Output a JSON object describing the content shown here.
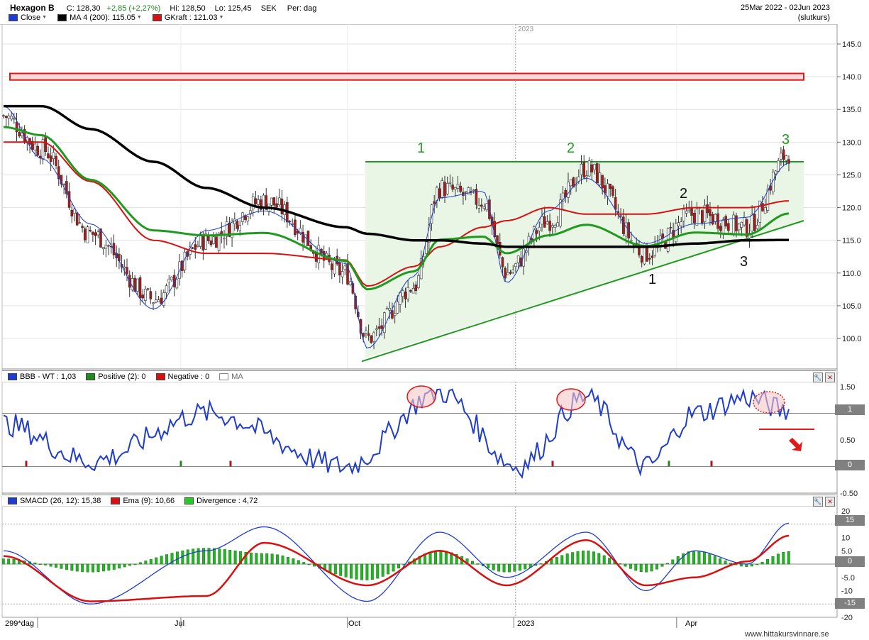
{
  "header": {
    "ticker": "Hexagon B",
    "close": "C: 128,30",
    "change": "+2,85 (+2,27%)",
    "high": "Hi: 128,50",
    "low": "Lo: 125,45",
    "currency": "SEK",
    "period": "Per: dag",
    "range": "25Mar 2022 - 02Jun 2023",
    "range_note": "(slutkurs)",
    "legend": [
      {
        "label": "Close",
        "color": "#1f3cd1"
      },
      {
        "label": "MA 4 (200): 115.05",
        "color": "#000000"
      },
      {
        "label": "GKraft : 121.03",
        "color": "#d81010"
      }
    ]
  },
  "colors": {
    "price_up": "#ffffff",
    "price_down": "#b01818",
    "ma200": "#000000",
    "ma_green": "#1f9a1f",
    "ma_red": "#d81010",
    "blue": "#1f3cd1",
    "resistance_box": "#e01818",
    "triangle_fill": "#e9f6e6",
    "triangle_line": "#1f9a1f"
  },
  "price_axis": {
    "ticks": [
      "145.0",
      "140.0",
      "135.0",
      "130.0",
      "125.0",
      "120.0",
      "115.0",
      "110.0",
      "105.0",
      "100.0"
    ]
  },
  "year_label": "2023",
  "annotations": {
    "green_1": "1",
    "green_2": "2",
    "green_3": "3",
    "black_1": "1",
    "black_2": "2",
    "black_3": "3"
  },
  "bbb_pane": {
    "legend": [
      {
        "label": "BBB - WT : 1,03",
        "color": "#1f3cd1"
      },
      {
        "label": "Positive (2): 0",
        "color": "#1f8a1f"
      },
      {
        "label": "Negative : 0",
        "color": "#d81010"
      },
      {
        "label": "MA",
        "color": "#ffffff"
      }
    ],
    "ticks": [
      "1.50",
      "0.50",
      "-0.50"
    ],
    "tags": [
      "1",
      "0"
    ]
  },
  "smacd_pane": {
    "legend": [
      {
        "label": "SMACD (26, 12): 15,38",
        "color": "#1f3cd1"
      },
      {
        "label": "Ema (9): 10,66",
        "color": "#d81010"
      },
      {
        "label": "Divergence : 4,72",
        "color": "#22cc22"
      }
    ],
    "ticks": [
      "20",
      "10",
      "5.0",
      "-5.0",
      "-10",
      "-20"
    ],
    "tags": [
      "15",
      "0",
      "-15"
    ]
  },
  "xaxis": {
    "first_label": "299*dag",
    "labels": [
      "Jul",
      "Oct",
      "2023",
      "Apr"
    ]
  },
  "footer": "www.hittakursvinnare.se",
  "chart_data": [
    {
      "type": "candlestick",
      "title": "Hexagon B",
      "x_range": [
        "2022-03-25",
        "2023-06-02"
      ],
      "ylim": [
        96,
        148
      ],
      "grid": true,
      "series": [
        {
          "name": "Close",
          "x": [
            "2022-03-25",
            "2022-04-15",
            "2022-05-12",
            "2022-06-16",
            "2022-07-15",
            "2022-08-16",
            "2022-09-30",
            "2022-10-12",
            "2022-11-07",
            "2022-11-21",
            "2022-12-15",
            "2022-12-28",
            "2023-01-20",
            "2023-02-10",
            "2023-03-15",
            "2023-04-11",
            "2023-05-10",
            "2023-06-02"
          ],
          "values": [
            134,
            129,
            116,
            106,
            115,
            121,
            110,
            100,
            108,
            123,
            121,
            110,
            118,
            126,
            113,
            119,
            117,
            128.3
          ]
        },
        {
          "name": "MA 4 (200)",
          "values": [
            135.5,
            135.5,
            132,
            127,
            123,
            120,
            117,
            116,
            115,
            115,
            114.5,
            114,
            114,
            114,
            114,
            114.5,
            115,
            115.05
          ]
        },
        {
          "name": "GKraft",
          "values": [
            130,
            130,
            124,
            115,
            113,
            113,
            112,
            108,
            111,
            114,
            117,
            118,
            120,
            119,
            119,
            120,
            120,
            121.03
          ]
        }
      ],
      "resistance_zone": [
        139.5,
        140.5
      ],
      "triangle": {
        "upper": 127,
        "lower_start": 97,
        "lower_end": 118
      }
    },
    {
      "type": "line",
      "title": "BBB - WT",
      "ylim": [
        -0.5,
        1.5
      ],
      "series": [
        {
          "name": "BBB - WT",
          "x": [
            "2022-03-25",
            "2022-05-12",
            "2022-07-15",
            "2022-09-30",
            "2022-11-21",
            "2023-01-03",
            "2023-02-10",
            "2023-03-15",
            "2023-04-11",
            "2023-05-10",
            "2023-06-02"
          ],
          "values": [
            0.8,
            0.1,
            1.0,
            0.0,
            1.4,
            0.0,
            1.3,
            0.0,
            1.0,
            1.3,
            1.03
          ]
        }
      ]
    },
    {
      "type": "line",
      "title": "SMACD (26, 12)",
      "ylim": [
        -20,
        20
      ],
      "series": [
        {
          "name": "SMACD (26, 12)",
          "x": [
            "2022-03-25",
            "2022-05-12",
            "2022-07-15",
            "2022-08-16",
            "2022-10-12",
            "2022-11-21",
            "2022-12-28",
            "2023-02-10",
            "2023-03-15",
            "2023-04-11",
            "2023-05-10",
            "2023-06-02"
          ],
          "values": [
            5,
            -15,
            5,
            14,
            -14,
            12,
            -5,
            12,
            -10,
            5,
            0,
            15.38
          ]
        },
        {
          "name": "Ema (9)",
          "values": [
            3,
            -14,
            -12,
            8,
            -8,
            5,
            -8,
            9,
            -8,
            -5,
            1,
            10.66
          ]
        },
        {
          "name": "Divergence",
          "values": [
            2,
            -3,
            6,
            4,
            -6,
            5,
            -3,
            5,
            -3,
            5,
            -1,
            4.72
          ]
        }
      ]
    }
  ]
}
